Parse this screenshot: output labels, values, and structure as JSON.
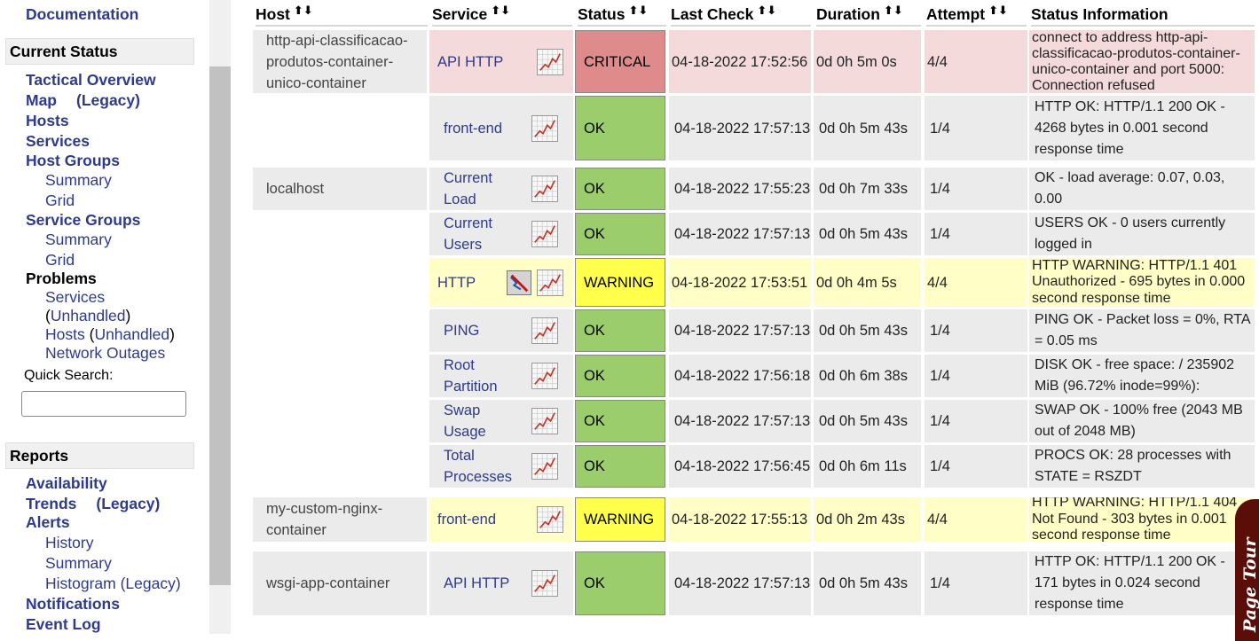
{
  "sidebar": {
    "top_link": "Documentation",
    "current_status": {
      "header": "Current Status",
      "tactical_overview": "Tactical Overview",
      "map": "Map",
      "map_legacy": "(Legacy)",
      "hosts": "Hosts",
      "services": "Services",
      "host_groups": "Host Groups",
      "host_groups_summary": "Summary",
      "host_groups_grid": "Grid",
      "service_groups": "Service Groups",
      "service_groups_summary": "Summary",
      "service_groups_grid": "Grid",
      "problems": "Problems",
      "problems_services": "Services",
      "problems_services_unhandled": "Unhandled",
      "problems_hosts": "Hosts",
      "problems_hosts_unhandled": "Unhandled",
      "network_outages": "Network Outages",
      "quick_search_label": "Quick Search:",
      "quick_search_value": ""
    },
    "reports": {
      "header": "Reports",
      "availability": "Availability",
      "trends": "Trends",
      "trends_legacy": "(Legacy)",
      "alerts": "Alerts",
      "alerts_history": "History",
      "alerts_summary": "Summary",
      "alerts_histogram": "Histogram (Legacy)",
      "notifications": "Notifications",
      "event_log": "Event Log"
    }
  },
  "table": {
    "columns": {
      "host": "Host",
      "service": "Service",
      "status": "Status",
      "last_check": "Last Check",
      "duration": "Duration",
      "attempt": "Attempt",
      "status_info": "Status Information"
    },
    "sort_glyph": "⬆⬇",
    "hosts": [
      "http-api-classificacao-produtos-container-unico-container",
      "localhost",
      "my-custom-nginx-container",
      "wsgi-app-container"
    ],
    "rows": [
      {
        "service": "API HTTP",
        "status": "CRITICAL",
        "last_check": "04-18-2022 17:52:56",
        "duration": "0d 0h 5m 0s",
        "attempt": "4/4",
        "info": "connect to address http-api-classificacao-produtos-container-unico-container and port 5000: Connection refused"
      },
      {
        "service": "front-end",
        "status": "OK",
        "last_check": "04-18-2022 17:57:13",
        "duration": "0d 0h 5m 43s",
        "attempt": "1/4",
        "info": "HTTP OK: HTTP/1.1 200 OK - 4268 bytes in 0.001 second response time"
      },
      {
        "service": "Current Load",
        "status": "OK",
        "last_check": "04-18-2022 17:55:23",
        "duration": "0d 0h 7m 33s",
        "attempt": "1/4",
        "info": "OK - load average: 0.07, 0.03, 0.00"
      },
      {
        "service": "Current Users",
        "status": "OK",
        "last_check": "04-18-2022 17:57:13",
        "duration": "0d 0h 5m 43s",
        "attempt": "1/4",
        "info": "USERS OK - 0 users currently logged in"
      },
      {
        "service": "HTTP",
        "status": "WARNING",
        "last_check": "04-18-2022 17:53:51",
        "duration": "0d 0h 4m 5s",
        "attempt": "4/4",
        "info": "HTTP WARNING: HTTP/1.1 401 Unauthorized - 695 bytes in 0.000 second response time"
      },
      {
        "service": "PING",
        "status": "OK",
        "last_check": "04-18-2022 17:57:13",
        "duration": "0d 0h 5m 43s",
        "attempt": "1/4",
        "info": "PING OK - Packet loss = 0%, RTA = 0.05 ms"
      },
      {
        "service": "Root Partition",
        "status": "OK",
        "last_check": "04-18-2022 17:56:18",
        "duration": "0d 0h 6m 38s",
        "attempt": "1/4",
        "info": "DISK OK - free space: / 235902 MiB (96.72% inode=99%):"
      },
      {
        "service": "Swap Usage",
        "status": "OK",
        "last_check": "04-18-2022 17:57:13",
        "duration": "0d 0h 5m 43s",
        "attempt": "1/4",
        "info": "SWAP OK - 100% free (2043 MB out of 2048 MB)"
      },
      {
        "service": "Total Processes",
        "status": "OK",
        "last_check": "04-18-2022 17:56:45",
        "duration": "0d 0h 6m 11s",
        "attempt": "1/4",
        "info": "PROCS OK: 28 processes with STATE = RSZDT"
      },
      {
        "service": "front-end",
        "status": "WARNING",
        "last_check": "04-18-2022 17:55:13",
        "duration": "0d 0h 2m 43s",
        "attempt": "4/4",
        "info": "HTTP WARNING: HTTP/1.1 404 Not Found - 303 bytes in 0.001 second response time"
      },
      {
        "service": "API HTTP",
        "status": "OK",
        "last_check": "04-18-2022 17:57:13",
        "duration": "0d 0h 5m 43s",
        "attempt": "1/4",
        "info": "HTTP OK: HTTP/1.1 200 OK - 171 bytes in 0.024 second response time"
      }
    ]
  },
  "page_tour": "Page Tour",
  "colors": {
    "ok": "#9ccd6c",
    "warning": "#ffff4c",
    "critical": "#e08b8b",
    "link": "#2e3a8c",
    "page_tour_bg": "#5b0e08"
  }
}
